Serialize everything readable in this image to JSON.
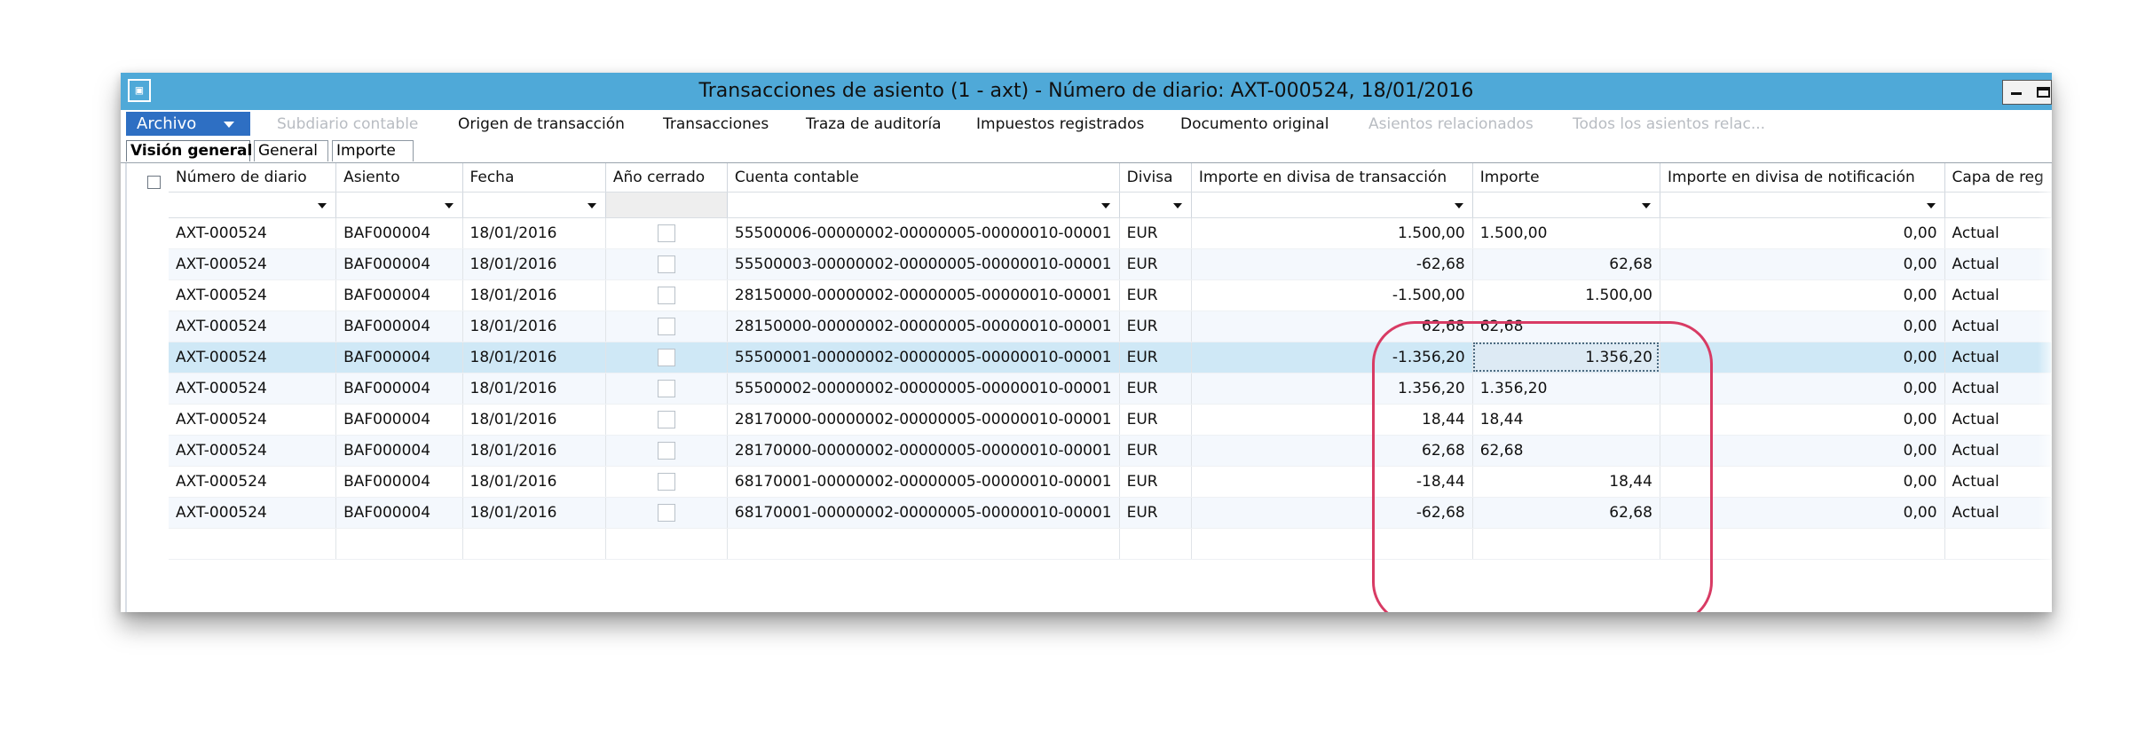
{
  "window": {
    "title": "Transacciones de asiento (1 - axt) - Número de diario: AXT-000524, 18/01/2016",
    "icon": "app-window-icon"
  },
  "menu": {
    "file": "Archivo",
    "items": [
      {
        "label": "Subdiario contable",
        "disabled": true
      },
      {
        "label": "Origen de transacción",
        "disabled": false
      },
      {
        "label": "Transacciones",
        "disabled": false
      },
      {
        "label": "Traza de auditoría",
        "disabled": false
      },
      {
        "label": "Impuestos registrados",
        "disabled": false
      },
      {
        "label": "Documento original",
        "disabled": false
      },
      {
        "label": "Asientos relacionados",
        "disabled": true
      },
      {
        "label": "Todos los asientos relac...",
        "disabled": true
      }
    ]
  },
  "tabs": [
    {
      "label": "Visión general",
      "active": true
    },
    {
      "label": "General",
      "active": false
    },
    {
      "label": "Importe",
      "active": false
    }
  ],
  "grid": {
    "columns": [
      "Número de diario",
      "Asiento",
      "Fecha",
      "Año cerrado",
      "Cuenta contable",
      "Divisa",
      "Importe en divisa de transacción",
      "Importe",
      "Importe en divisa de notificación",
      "Capa de reg"
    ],
    "rows": [
      {
        "journal": "AXT-000524",
        "voucher": "BAF000004",
        "date": "18/01/2016",
        "closed": false,
        "account": "55500006-00000002-00000005-00000010-00001",
        "currency": "EUR",
        "amount_tx": "1.500,00",
        "debit": "1.500,00",
        "credit": "",
        "report_amount": "0,00",
        "layer": "Actual",
        "selected": false
      },
      {
        "journal": "AXT-000524",
        "voucher": "BAF000004",
        "date": "18/01/2016",
        "closed": false,
        "account": "55500003-00000002-00000005-00000010-00001",
        "currency": "EUR",
        "amount_tx": "-62,68",
        "debit": "",
        "credit": "62,68",
        "report_amount": "0,00",
        "layer": "Actual",
        "selected": false
      },
      {
        "journal": "AXT-000524",
        "voucher": "BAF000004",
        "date": "18/01/2016",
        "closed": false,
        "account": "28150000-00000002-00000005-00000010-00001",
        "currency": "EUR",
        "amount_tx": "-1.500,00",
        "debit": "",
        "credit": "1.500,00",
        "report_amount": "0,00",
        "layer": "Actual",
        "selected": false
      },
      {
        "journal": "AXT-000524",
        "voucher": "BAF000004",
        "date": "18/01/2016",
        "closed": false,
        "account": "28150000-00000002-00000005-00000010-00001",
        "currency": "EUR",
        "amount_tx": "62,68",
        "debit": "62,68",
        "credit": "",
        "report_amount": "0,00",
        "layer": "Actual",
        "selected": false
      },
      {
        "journal": "AXT-000524",
        "voucher": "BAF000004",
        "date": "18/01/2016",
        "closed": false,
        "account": "55500001-00000002-00000005-00000010-00001",
        "currency": "EUR",
        "amount_tx": "-1.356,20",
        "debit": "",
        "credit": "1.356,20",
        "report_amount": "0,00",
        "layer": "Actual",
        "selected": true
      },
      {
        "journal": "AXT-000524",
        "voucher": "BAF000004",
        "date": "18/01/2016",
        "closed": false,
        "account": "55500002-00000002-00000005-00000010-00001",
        "currency": "EUR",
        "amount_tx": "1.356,20",
        "debit": "1.356,20",
        "credit": "",
        "report_amount": "0,00",
        "layer": "Actual",
        "selected": false
      },
      {
        "journal": "AXT-000524",
        "voucher": "BAF000004",
        "date": "18/01/2016",
        "closed": false,
        "account": "28170000-00000002-00000005-00000010-00001",
        "currency": "EUR",
        "amount_tx": "18,44",
        "debit": "18,44",
        "credit": "",
        "report_amount": "0,00",
        "layer": "Actual",
        "selected": false
      },
      {
        "journal": "AXT-000524",
        "voucher": "BAF000004",
        "date": "18/01/2016",
        "closed": false,
        "account": "28170000-00000002-00000005-00000010-00001",
        "currency": "EUR",
        "amount_tx": "62,68",
        "debit": "62,68",
        "credit": "",
        "report_amount": "0,00",
        "layer": "Actual",
        "selected": false
      },
      {
        "journal": "AXT-000524",
        "voucher": "BAF000004",
        "date": "18/01/2016",
        "closed": false,
        "account": "68170001-00000002-00000005-00000010-00001",
        "currency": "EUR",
        "amount_tx": "-18,44",
        "debit": "",
        "credit": "18,44",
        "report_amount": "0,00",
        "layer": "Actual",
        "selected": false
      },
      {
        "journal": "AXT-000524",
        "voucher": "BAF000004",
        "date": "18/01/2016",
        "closed": false,
        "account": "68170001-00000002-00000005-00000010-00001",
        "currency": "EUR",
        "amount_tx": "-62,68",
        "debit": "",
        "credit": "62,68",
        "report_amount": "0,00",
        "layer": "Actual",
        "selected": false
      }
    ]
  },
  "colors": {
    "title_bar": "#4fa9d8",
    "file_button": "#2e6fc3",
    "selected_row": "#cfe8f6",
    "annotation_oval": "#d83b64"
  }
}
